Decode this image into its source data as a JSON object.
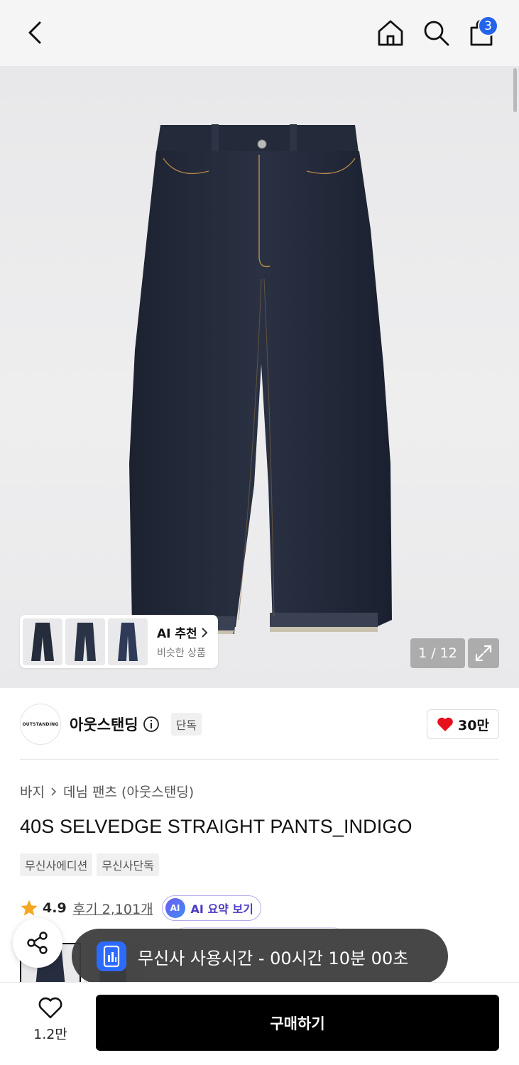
{
  "header": {
    "cart_count": "3"
  },
  "gallery": {
    "counter": "1 / 12",
    "ai_recommend_title": "AI 추천",
    "ai_recommend_subtitle": "비슷한 상품"
  },
  "brand": {
    "logo_text": "OUTSTANDING",
    "name": "아웃스탠딩",
    "exclusive_badge": "단독",
    "like_count": "30만"
  },
  "breadcrumb": {
    "category": "바지",
    "subcategory": "데님 팬츠 (아웃스탠딩)"
  },
  "product": {
    "title": "40S SELVEDGE STRAIGHT PANTS_INDIGO",
    "tags": [
      "무신사에디션",
      "무신사단독"
    ]
  },
  "rating": {
    "score": "4.9",
    "review_label": "후기 2,101개",
    "ai_summary_label": "AI 요약 보기",
    "ai_logo": "AI"
  },
  "toast": {
    "text": "무신사 사용시간 - 00시간 10분 00초"
  },
  "bottom": {
    "wish_count": "1.2만",
    "buy_label": "구매하기"
  },
  "colors": {
    "accent_blue": "#2563eb",
    "heart_red": "#e8101c",
    "star_orange": "#f5a623",
    "ai_purple": "#4b3ac4"
  }
}
